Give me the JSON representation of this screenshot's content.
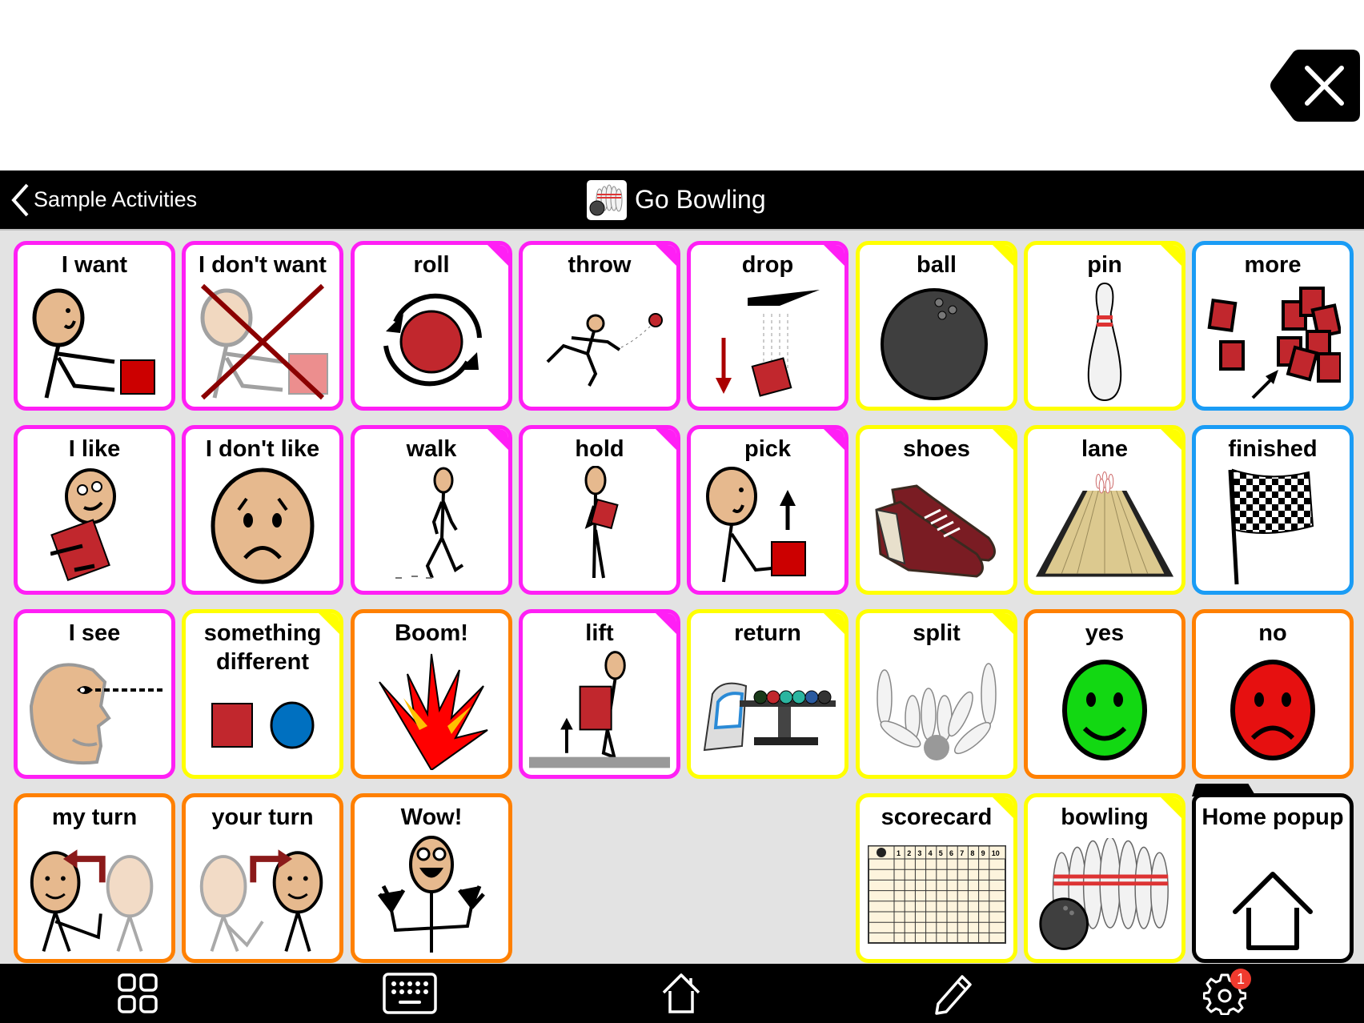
{
  "message_bar": {
    "text": "",
    "delete_icon": "delete-backspace-icon"
  },
  "header": {
    "back_label": "Sample Activities",
    "title": "Go Bowling",
    "title_icon": "bowling-pins-icon"
  },
  "colors": {
    "people_border": "#ff1ff5",
    "noun_border": "#ffff00",
    "social_border": "#ff8000",
    "adjective_border": "#1a9cf5",
    "nav_border": "#000000"
  },
  "tiles": [
    {
      "label": "I want",
      "border": "people_border",
      "folder": false,
      "icon": "i-want-icon",
      "row": 0,
      "col": 0
    },
    {
      "label": "I don't want",
      "border": "people_border",
      "folder": false,
      "icon": "i-dont-want-icon",
      "row": 0,
      "col": 1
    },
    {
      "label": "roll",
      "border": "people_border",
      "folder": true,
      "icon": "roll-icon",
      "row": 0,
      "col": 2
    },
    {
      "label": "throw",
      "border": "people_border",
      "folder": true,
      "icon": "throw-icon",
      "row": 0,
      "col": 3
    },
    {
      "label": "drop",
      "border": "people_border",
      "folder": true,
      "icon": "drop-icon",
      "row": 0,
      "col": 4
    },
    {
      "label": "ball",
      "border": "noun_border",
      "folder": true,
      "icon": "bowling-ball-icon",
      "row": 0,
      "col": 5
    },
    {
      "label": "pin",
      "border": "noun_border",
      "folder": true,
      "icon": "bowling-pin-icon",
      "row": 0,
      "col": 6
    },
    {
      "label": "more",
      "border": "adjective_border",
      "folder": false,
      "icon": "more-icon",
      "row": 0,
      "col": 7
    },
    {
      "label": "I like",
      "border": "people_border",
      "folder": false,
      "icon": "i-like-icon",
      "row": 1,
      "col": 0
    },
    {
      "label": "I don't like",
      "border": "people_border",
      "folder": false,
      "icon": "sad-face-icon",
      "row": 1,
      "col": 1
    },
    {
      "label": "walk",
      "border": "people_border",
      "folder": true,
      "icon": "walk-icon",
      "row": 1,
      "col": 2
    },
    {
      "label": "hold",
      "border": "people_border",
      "folder": true,
      "icon": "hold-icon",
      "row": 1,
      "col": 3
    },
    {
      "label": "pick",
      "border": "people_border",
      "folder": true,
      "icon": "pick-icon",
      "row": 1,
      "col": 4
    },
    {
      "label": "shoes",
      "border": "noun_border",
      "folder": true,
      "icon": "bowling-shoes-icon",
      "row": 1,
      "col": 5
    },
    {
      "label": "lane",
      "border": "noun_border",
      "folder": true,
      "icon": "bowling-lane-icon",
      "row": 1,
      "col": 6
    },
    {
      "label": "finished",
      "border": "adjective_border",
      "folder": false,
      "icon": "checkered-flag-icon",
      "row": 1,
      "col": 7
    },
    {
      "label": "I see",
      "border": "people_border",
      "folder": false,
      "icon": "i-see-icon",
      "row": 2,
      "col": 0
    },
    {
      "label": "something different",
      "border": "noun_border",
      "folder": true,
      "icon": "something-different-icon",
      "row": 2,
      "col": 1
    },
    {
      "label": "Boom!",
      "border": "social_border",
      "folder": false,
      "icon": "explosion-icon",
      "row": 2,
      "col": 2
    },
    {
      "label": "lift",
      "border": "people_border",
      "folder": true,
      "icon": "lift-icon",
      "row": 2,
      "col": 3
    },
    {
      "label": "return",
      "border": "noun_border",
      "folder": true,
      "icon": "ball-return-icon",
      "row": 2,
      "col": 4
    },
    {
      "label": "split",
      "border": "noun_border",
      "folder": true,
      "icon": "split-pins-icon",
      "row": 2,
      "col": 5
    },
    {
      "label": "yes",
      "border": "social_border",
      "folder": false,
      "icon": "happy-green-face-icon",
      "row": 2,
      "col": 6
    },
    {
      "label": "no",
      "border": "social_border",
      "folder": false,
      "icon": "sad-red-face-icon",
      "row": 2,
      "col": 7
    },
    {
      "label": "my turn",
      "border": "social_border",
      "folder": false,
      "icon": "my-turn-icon",
      "row": 3,
      "col": 0
    },
    {
      "label": "your turn",
      "border": "social_border",
      "folder": false,
      "icon": "your-turn-icon",
      "row": 3,
      "col": 1
    },
    {
      "label": "Wow!",
      "border": "social_border",
      "folder": false,
      "icon": "wow-icon",
      "row": 3,
      "col": 2
    },
    {
      "label": "scorecard",
      "border": "noun_border",
      "folder": true,
      "icon": "scorecard-icon",
      "row": 3,
      "col": 5
    },
    {
      "label": "bowling",
      "border": "noun_border",
      "folder": true,
      "icon": "bowling-icon",
      "row": 3,
      "col": 6
    },
    {
      "label": "Home popup",
      "border": "nav_border",
      "folder": false,
      "home_popup": true,
      "icon": "home-icon",
      "row": 3,
      "col": 7
    }
  ],
  "scorecard_frames": [
    "1",
    "2",
    "3",
    "4",
    "5",
    "6",
    "7",
    "8",
    "9",
    "10"
  ],
  "bottom_bar": {
    "items": [
      {
        "name": "grid-icon"
      },
      {
        "name": "keyboard-icon"
      },
      {
        "name": "home-icon"
      },
      {
        "name": "pencil-icon"
      },
      {
        "name": "gear-icon",
        "badge": "1"
      }
    ]
  }
}
